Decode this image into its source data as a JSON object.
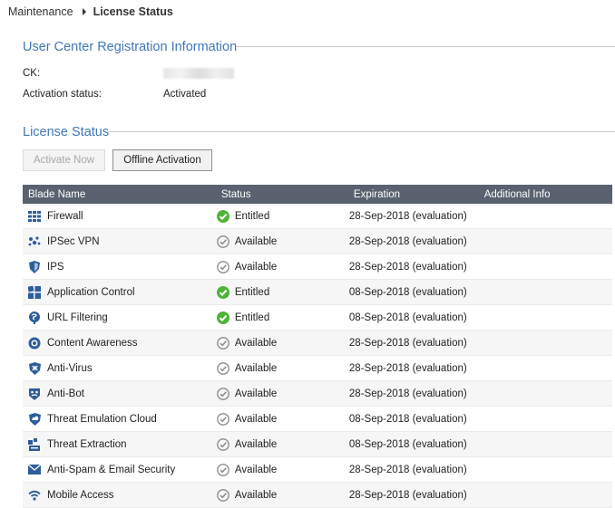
{
  "breadcrumb": {
    "parent": "Maintenance",
    "current": "License Status"
  },
  "registration": {
    "title": "User Center Registration Information",
    "ck_label": "CK:",
    "activation_label": "Activation status:",
    "activation_value": "Activated"
  },
  "license": {
    "title": "License Status",
    "activate_now": "Activate Now",
    "offline_activation": "Offline Activation",
    "columns": [
      "Blade Name",
      "Status",
      "Expiration",
      "Additional Info"
    ],
    "rows": [
      {
        "name": "Firewall",
        "icon": "firewall-icon",
        "status": "Entitled",
        "expiration": "28-Sep-2018 (evaluation)",
        "info": ""
      },
      {
        "name": "IPSec VPN",
        "icon": "vpn-icon",
        "status": "Available",
        "expiration": "28-Sep-2018 (evaluation)",
        "info": ""
      },
      {
        "name": "IPS",
        "icon": "ips-shield-icon",
        "status": "Available",
        "expiration": "28-Sep-2018 (evaluation)",
        "info": ""
      },
      {
        "name": "Application Control",
        "icon": "app-control-icon",
        "status": "Entitled",
        "expiration": "08-Sep-2018 (evaluation)",
        "info": ""
      },
      {
        "name": "URL Filtering",
        "icon": "url-filtering-icon",
        "status": "Entitled",
        "expiration": "08-Sep-2018 (evaluation)",
        "info": ""
      },
      {
        "name": "Content Awareness",
        "icon": "content-awareness-icon",
        "status": "Available",
        "expiration": "28-Sep-2018 (evaluation)",
        "info": ""
      },
      {
        "name": "Anti-Virus",
        "icon": "anti-virus-icon",
        "status": "Available",
        "expiration": "28-Sep-2018 (evaluation)",
        "info": ""
      },
      {
        "name": "Anti-Bot",
        "icon": "anti-bot-icon",
        "status": "Available",
        "expiration": "28-Sep-2018 (evaluation)",
        "info": ""
      },
      {
        "name": "Threat Emulation Cloud",
        "icon": "threat-emulation-icon",
        "status": "Available",
        "expiration": "08-Sep-2018 (evaluation)",
        "info": ""
      },
      {
        "name": "Threat Extraction",
        "icon": "threat-extraction-icon",
        "status": "Available",
        "expiration": "08-Sep-2018 (evaluation)",
        "info": ""
      },
      {
        "name": "Anti-Spam & Email Security",
        "icon": "email-icon",
        "status": "Available",
        "expiration": "28-Sep-2018 (evaluation)",
        "info": ""
      },
      {
        "name": "Mobile Access",
        "icon": "wifi-icon",
        "status": "Available",
        "expiration": "28-Sep-2018 (evaluation)",
        "info": ""
      }
    ]
  },
  "colors": {
    "accent": "#3f79b5",
    "header_bg": "#59626e",
    "entitled": "#4fb33a",
    "available": "#8a8a8a"
  }
}
